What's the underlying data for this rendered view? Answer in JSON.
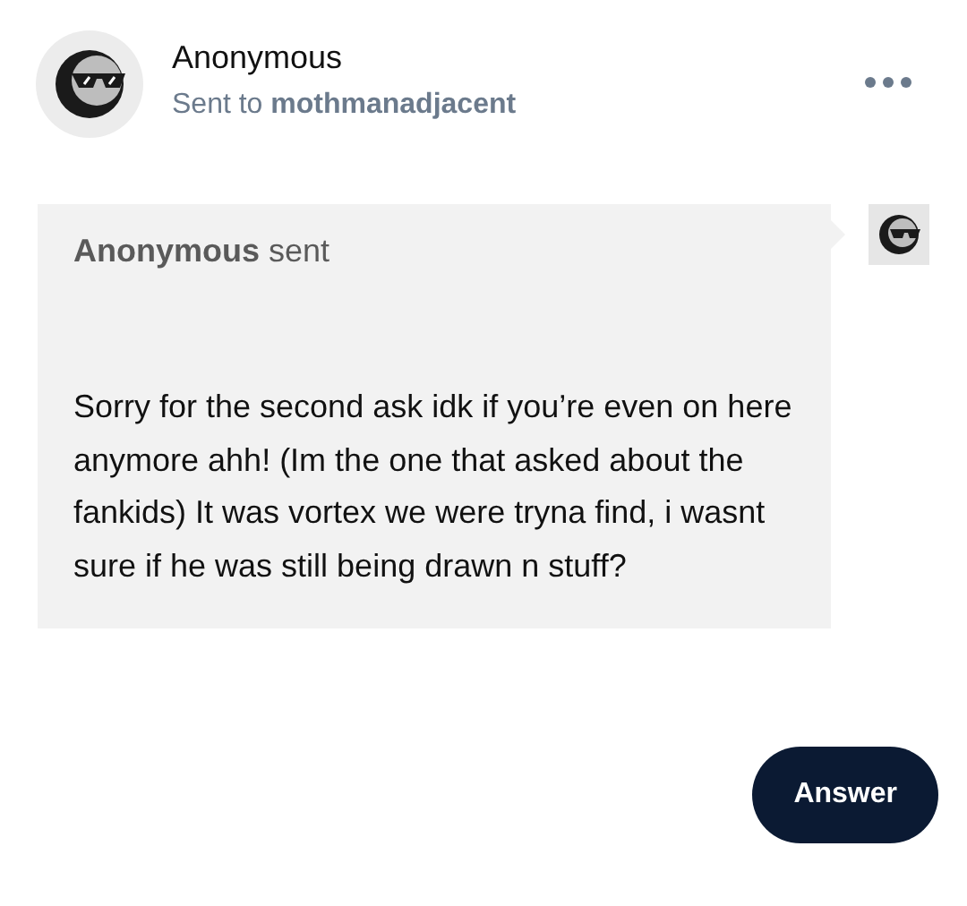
{
  "header": {
    "name": "Anonymous",
    "subtitle": "Sent to **mothmanadjacent**"
  },
  "message": {
    "heading": "**Anonymous** sent",
    "body": "Sorry for the second ask idk if you’re even on here anymore ahh! (Im the one that asked about the fankids) It was vortex we were tryna find, i wasnt sure if he was still being drawn n stuff?"
  },
  "buttons": [
    {
      "label": "Answer"
    }
  ]
}
